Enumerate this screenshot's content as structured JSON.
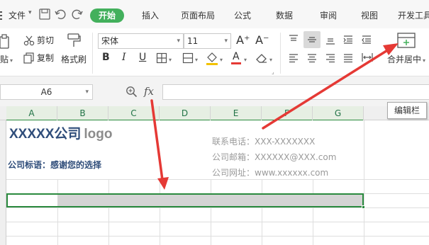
{
  "menu": {
    "file": "文件",
    "tabs": [
      "开始",
      "插入",
      "页面布局",
      "公式",
      "数据",
      "审阅",
      "视图",
      "开发工具"
    ],
    "active_tab": "开始"
  },
  "ribbon": {
    "paste_label": "贴",
    "cut_label": "剪切",
    "copy_label": "复制",
    "format_painter_label": "格式刷",
    "font_name": "宋体",
    "font_size": "11",
    "bold": "B",
    "italic": "I",
    "underline": "U",
    "grow_font": "A⁺",
    "shrink_font": "A⁻",
    "font_color_glyph": "A",
    "merge_center_label": "合并居中"
  },
  "formula_bar": {
    "name_box": "A6",
    "fx_label": "fx",
    "content": "",
    "tooltip": "编辑栏"
  },
  "grid": {
    "columns": [
      "A",
      "B",
      "C",
      "D",
      "E",
      "F",
      "G"
    ],
    "selected_range": "A6:G6"
  },
  "sheet": {
    "company_name": "XXXXX公司",
    "logo_text": "logo",
    "slogan": "公司标语：感谢您的选择",
    "phone": "联系电话：XXX-XXXXXXX",
    "email": "公司邮箱：XXXXXX@XXX.com",
    "website": "公司网址：www.xxxxxx.com"
  },
  "colors": {
    "accent_green": "#43b05c",
    "selection_border": "#2a8a3e",
    "annotation_arrow": "#e53935",
    "company_text": "#2f4d7a"
  }
}
